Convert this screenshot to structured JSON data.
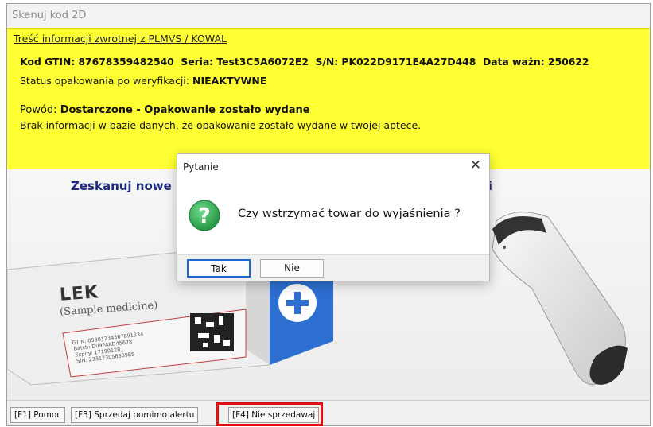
{
  "window": {
    "title": "Skanuj kod 2D"
  },
  "info": {
    "header": "Treść informacji zwrotnej z PLMVS / KOWAL",
    "gtin_label": "Kod GTIN:",
    "gtin_value": "87678359482540",
    "seria_label": "Seria:",
    "seria_value": "Test3C5A6072E2",
    "sn_label": "S/N:",
    "sn_value": "PK022D9171E4A27D448",
    "expiry_label": "Data ważn:",
    "expiry_value": "250622",
    "status_label": "Status opakowania po weryfikacji:",
    "status_value": "NIEAKTYWNE",
    "reason_label": "Powód:",
    "reason_value": "Dostarczone - Opakowanie zostało wydane",
    "reason_detail": "Brak informacji w bazie danych, że opakowanie zostało wydane w twojej aptece."
  },
  "content": {
    "scan_text": "Zeskanuj nowe",
    "scan_text_tail": "pcji",
    "product_name": "LEK",
    "product_sub": "(Sample medicine)",
    "label_lines": [
      "GTIN:",
      "Batch:",
      "Expiry:",
      "S/N:"
    ],
    "label_values": [
      "09301234567891234",
      "D09PAKD45678",
      "17190128",
      "23312305650985"
    ]
  },
  "dialog": {
    "title": "Pytanie",
    "close": "✕",
    "message": "Czy wstrzymać towar do wyjaśnienia ?",
    "yes_label": "Tak",
    "no_label": "Nie",
    "icon": "question-icon"
  },
  "toolbar": {
    "f1_label": "[F1] Pomoc",
    "f3_label": "[F3] Sprzedaj pomimo alertu",
    "f4_label": "[F4] Nie sprzedawaj"
  },
  "colors": {
    "info_bg": "#ffff33",
    "scan_text": "#1f2a80",
    "highlight": "#e01010",
    "question_green": "#2fa84f",
    "default_button_border": "#1a66d1"
  }
}
